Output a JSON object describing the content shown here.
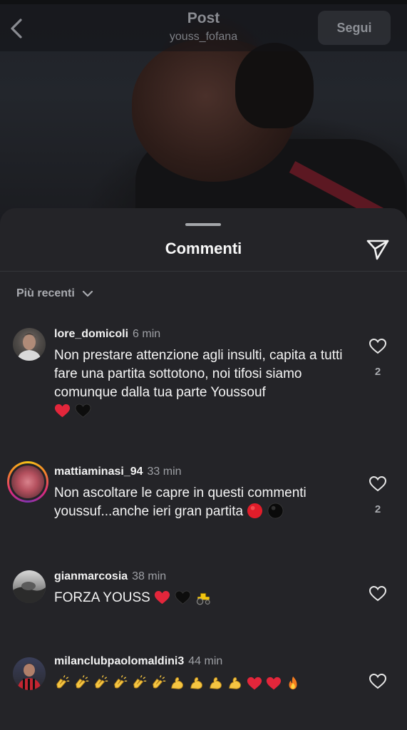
{
  "header": {
    "title": "Post",
    "username": "youss_fofana",
    "follow_label": "Segui"
  },
  "sheet": {
    "title": "Commenti",
    "sort_label": "Più recenti"
  },
  "comments": [
    {
      "username": "lore_domicoli",
      "time": "6 min",
      "text": "Non prestare attenzione agli insulti, capita a tutti fare una partita sottotono, noi tifosi siamo comunque dalla tua parte Youssouf",
      "emojis": [
        "red-heart",
        "black-heart"
      ],
      "likes": "2"
    },
    {
      "username": "mattiaminasi_94",
      "time": "33 min",
      "text": "Non ascoltare le capre in questi commenti youssuf...anche ieri gran partita",
      "emojis": [
        "red-circle",
        "black-circle"
      ],
      "likes": "2"
    },
    {
      "username": "gianmarcosia",
      "time": "38 min",
      "text": "FORZA YOUSS",
      "emojis": [
        "red-heart",
        "black-heart",
        "tractor"
      ],
      "likes": ""
    },
    {
      "username": "milanclubpaolomaldini3",
      "time": "44 min",
      "text": "",
      "emojis": [
        "clapping-hands",
        "clapping-hands",
        "clapping-hands",
        "clapping-hands",
        "clapping-hands",
        "clapping-hands",
        "flexed-biceps",
        "flexed-biceps",
        "flexed-biceps",
        "flexed-biceps",
        "red-heart",
        "red-heart",
        "fire"
      ],
      "likes": ""
    }
  ],
  "colors": {
    "sheet_background": "#242428",
    "accent_red": "#e0263a"
  }
}
